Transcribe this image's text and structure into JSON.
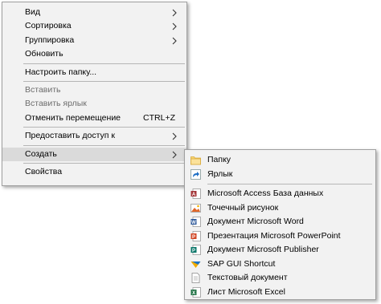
{
  "context_menu": {
    "items": [
      {
        "label": "Вид"
      },
      {
        "label": "Сортировка"
      },
      {
        "label": "Группировка"
      },
      {
        "label": "Обновить"
      },
      {
        "label": "Настроить папку..."
      },
      {
        "label": "Вставить"
      },
      {
        "label": "Вставить ярлык"
      },
      {
        "label": "Отменить перемещение",
        "shortcut": "CTRL+Z"
      },
      {
        "label": "Предоставить доступ к"
      },
      {
        "label": "Создать"
      },
      {
        "label": "Свойства"
      }
    ]
  },
  "submenu": {
    "items": [
      {
        "label": "Папку",
        "icon": "folder-icon"
      },
      {
        "label": "Ярлык",
        "icon": "shortcut-icon"
      },
      {
        "label": "Microsoft Access База данных",
        "icon": "access-icon"
      },
      {
        "label": "Точечный рисунок",
        "icon": "bitmap-icon"
      },
      {
        "label": "Документ Microsoft Word",
        "icon": "word-icon"
      },
      {
        "label": "Презентация Microsoft PowerPoint",
        "icon": "powerpoint-icon"
      },
      {
        "label": "Документ Microsoft Publisher",
        "icon": "publisher-icon"
      },
      {
        "label": "SAP GUI Shortcut",
        "icon": "sap-icon"
      },
      {
        "label": "Текстовый документ",
        "icon": "text-document-icon"
      },
      {
        "label": "Лист Microsoft Excel",
        "icon": "excel-icon"
      }
    ]
  },
  "colors": {
    "menu_bg": "#f2f2f2",
    "highlight": "#dadada",
    "disabled_text": "#6d6d6d",
    "word": "#2b579a",
    "excel": "#217346",
    "powerpoint": "#d24726",
    "access": "#a4373a",
    "publisher": "#077568",
    "folder": "#f8d775"
  }
}
